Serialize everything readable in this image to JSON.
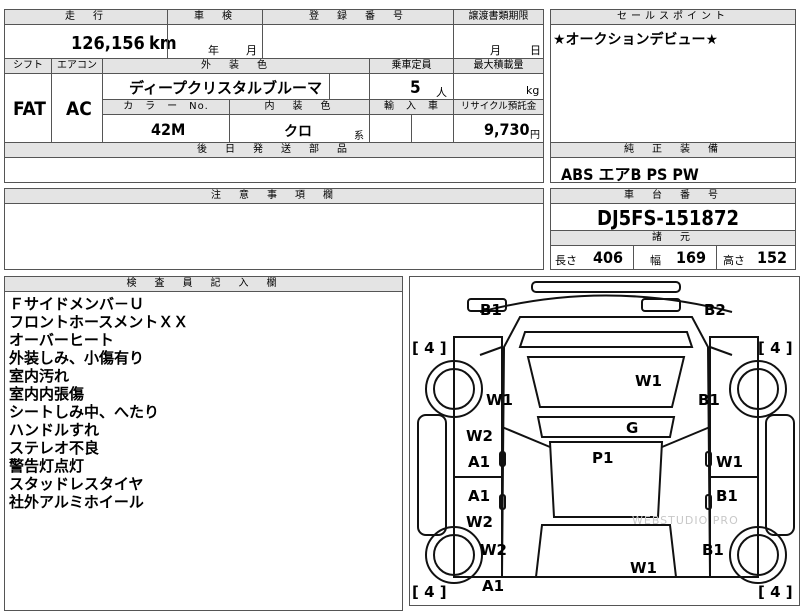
{
  "header": {
    "mileage_label": "走　行",
    "shaken_label": "車　検",
    "reg_label": "登　録　番　号",
    "transfer_label": "譲渡書類期限",
    "sales_label": "セールスポイント"
  },
  "mileage": {
    "value": "126,156",
    "unit": "km"
  },
  "shaken": {
    "year_unit": "年",
    "month_unit": "月"
  },
  "transfer": {
    "month_unit": "月",
    "day_unit": "日"
  },
  "sales_point": "★オークションデビュー★",
  "row2": {
    "shift_label": "シフト",
    "aircon_label": "エアコン",
    "exterior_label": "外　装　色",
    "capacity_label": "乗車定員",
    "max_load_label": "最大積載量",
    "shift": "FAT",
    "aircon": "AC",
    "exterior": "ディープクリスタルブルーマ",
    "capacity": "5",
    "capacity_unit": "人",
    "load_unit": "kg",
    "colorno_label": "カ　ラ　ー　No.",
    "interior_label": "内　装　色",
    "import_label": "輸　入　車",
    "recycle_label": "リサイクル預託金",
    "colorno": "42M",
    "interior": "クロ",
    "interior_unit": "系",
    "recycle": "9,730",
    "recycle_unit": "円"
  },
  "later_parts_label": "後　日　発　送　部　品",
  "genuine_label": "純　正　装　備",
  "genuine": "ABS エアB PS PW",
  "notes_label": "注　意　事　項　欄",
  "chassis_label": "車　台　番　号",
  "chassis": "DJ5FS-151872",
  "specs_label": "諸　元",
  "specs": {
    "length_label": "長さ",
    "length": "406",
    "width_label": "幅",
    "width": "169",
    "height_label": "高さ",
    "height": "152"
  },
  "inspector_label": "検　査　員　記　入　欄",
  "inspector_notes": [
    "Ｆサイドメンバ－Ｕ",
    "フロントホースメントＸＸ",
    "オーバーヒート",
    "外装しみ、小傷有り",
    "室内汚れ",
    "室内内張傷",
    "シートしみ中、へたり",
    "ハンドルすれ",
    "ステレオ不良",
    "警告灯点灯",
    "スタッドレスタイヤ",
    "社外アルミホイール"
  ],
  "diagram": {
    "tire_fl": "[ 4 ]",
    "tire_fr": "[ 4 ]",
    "tire_rl": "[ 4 ]",
    "tire_rr": "[ 4 ]",
    "marks": [
      "B1",
      "B2",
      "W1",
      "W1",
      "B1",
      "W2",
      "G",
      "A1",
      "P1",
      "W1",
      "A1",
      "B1",
      "W2",
      "W2",
      "B1",
      "W1",
      "A1"
    ],
    "watermark": "WEBSTUDIO PRO"
  }
}
